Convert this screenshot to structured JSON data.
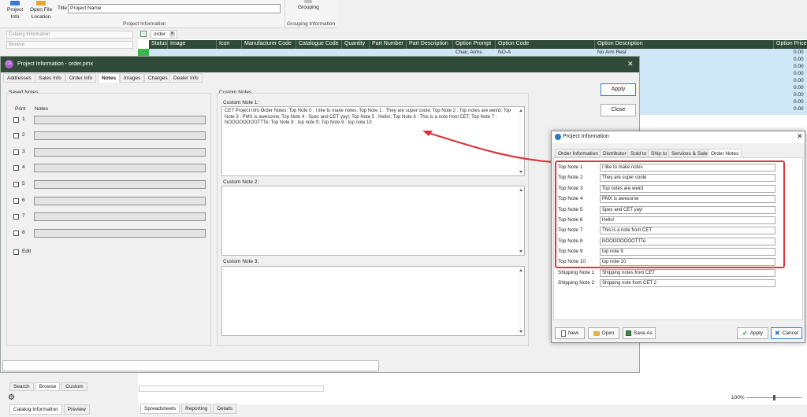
{
  "ribbon": {
    "project_info": "Project\nInfo",
    "open_file_location": "Open File\nLocation",
    "title_label": "Title",
    "title_value": "Project Name",
    "group_project_info": "Project Information",
    "grouping": "Grouping",
    "group_grouping_info": "Grouping Information"
  },
  "left_panel": {
    "catalog_info_placeholder": "Catalog Information",
    "browse_placeholder": "Browse",
    "tabs": [
      "Search",
      "Browse",
      "Custom"
    ],
    "bottom_tabs": [
      "Catalog Information",
      "Preview"
    ]
  },
  "grid": {
    "tab_label": "order",
    "columns": [
      "Status",
      "Image",
      "Icon",
      "Manufacturer Code",
      "Catalogue Code",
      "Quantity",
      "Part Number",
      "Part Description",
      "Option Prompt",
      "Option Code",
      "Option Description",
      "Option Price"
    ],
    "first_row": {
      "option_prompt": "Chair, Arms",
      "option_code": "NO-A",
      "option_description": "No Arm Rest"
    },
    "prices": [
      "0.00",
      "0.00",
      "0.00",
      "0.00",
      "0.00",
      "0.00",
      "0.00",
      "0.00",
      "0.00"
    ],
    "bottom_tabs": [
      "Spreadsheets",
      "Reporting",
      "Details"
    ],
    "zoom": "100%"
  },
  "project_window": {
    "title": "Project Information - order.pmx",
    "tabs": [
      "Addresses",
      "Sales Info",
      "Order Info",
      "Notes",
      "Images",
      "Charges",
      "Dealer Info"
    ],
    "active_tab": "Notes",
    "saved_notes_label": "Saved Notes",
    "print_label": "Print",
    "notes_label": "Notes",
    "rows": [
      "1",
      "2",
      "3",
      "4",
      "5",
      "6",
      "7",
      "8"
    ],
    "edit_label": "Edit",
    "custom_notes_label": "Custom Notes",
    "custom_note_1_label": "Custom Note 1:",
    "custom_note_1_text": "CET Project Info Order Notes: Top Note 0 : I like to make notes;  Top Note 1 : They are super coole;  Top Note 2 : Top notes are weird;  Top Note 3 : PMX is awesome;  Top Note 4 : Spec and CET yay!;  Top Note 5 : Hello!;  Top Note 6 : This is a note from CET;  Top Note 7 : NOOOOOOOOTTTe;  Top Note 8 : top note 9;  Top Note 9 : top note 10",
    "custom_note_2_label": "Custom Note 2:",
    "custom_note_3_label": "Custom Note 3:",
    "apply": "Apply",
    "close": "Close"
  },
  "dialog": {
    "title": "Project Information",
    "tabs": [
      "Order Information",
      "Distributor",
      "Sold to",
      "Ship to",
      "Services & Sales",
      "Order Notes"
    ],
    "active_tab": "Order Notes",
    "notes": [
      {
        "label": "Top Note 1",
        "value": "I like to make notes"
      },
      {
        "label": "Top Note 2",
        "value": "They are super coole"
      },
      {
        "label": "Top Note 3",
        "value": "Top notes are weird"
      },
      {
        "label": "Top Note 4",
        "value": "PMX is awesome"
      },
      {
        "label": "Top Note 5",
        "value": "Spec and CET yay!"
      },
      {
        "label": "Top Note 6",
        "value": "Hello!"
      },
      {
        "label": "Top Note 7",
        "value": "This is a note from CET"
      },
      {
        "label": "Top Note 8",
        "value": "NOOOOOOOOTTTe"
      },
      {
        "label": "Top Note 9",
        "value": "top note 9"
      },
      {
        "label": "Top Note 10",
        "value": "top note 10"
      }
    ],
    "shipping": [
      {
        "label": "Shipping Note 1",
        "value": "Shipping notes from CET"
      },
      {
        "label": "Shipping Note 2",
        "value": "Shipping note from CET 2"
      }
    ],
    "new": "New",
    "open": "Open",
    "save_as": "Save As",
    "apply": "Apply",
    "cancel": "Cancel"
  },
  "colors": {
    "title_bar": "#2f4a36",
    "highlight_box": "#e0343a",
    "arrow": "#d9363c",
    "grid_row": "#cfe6f7"
  }
}
